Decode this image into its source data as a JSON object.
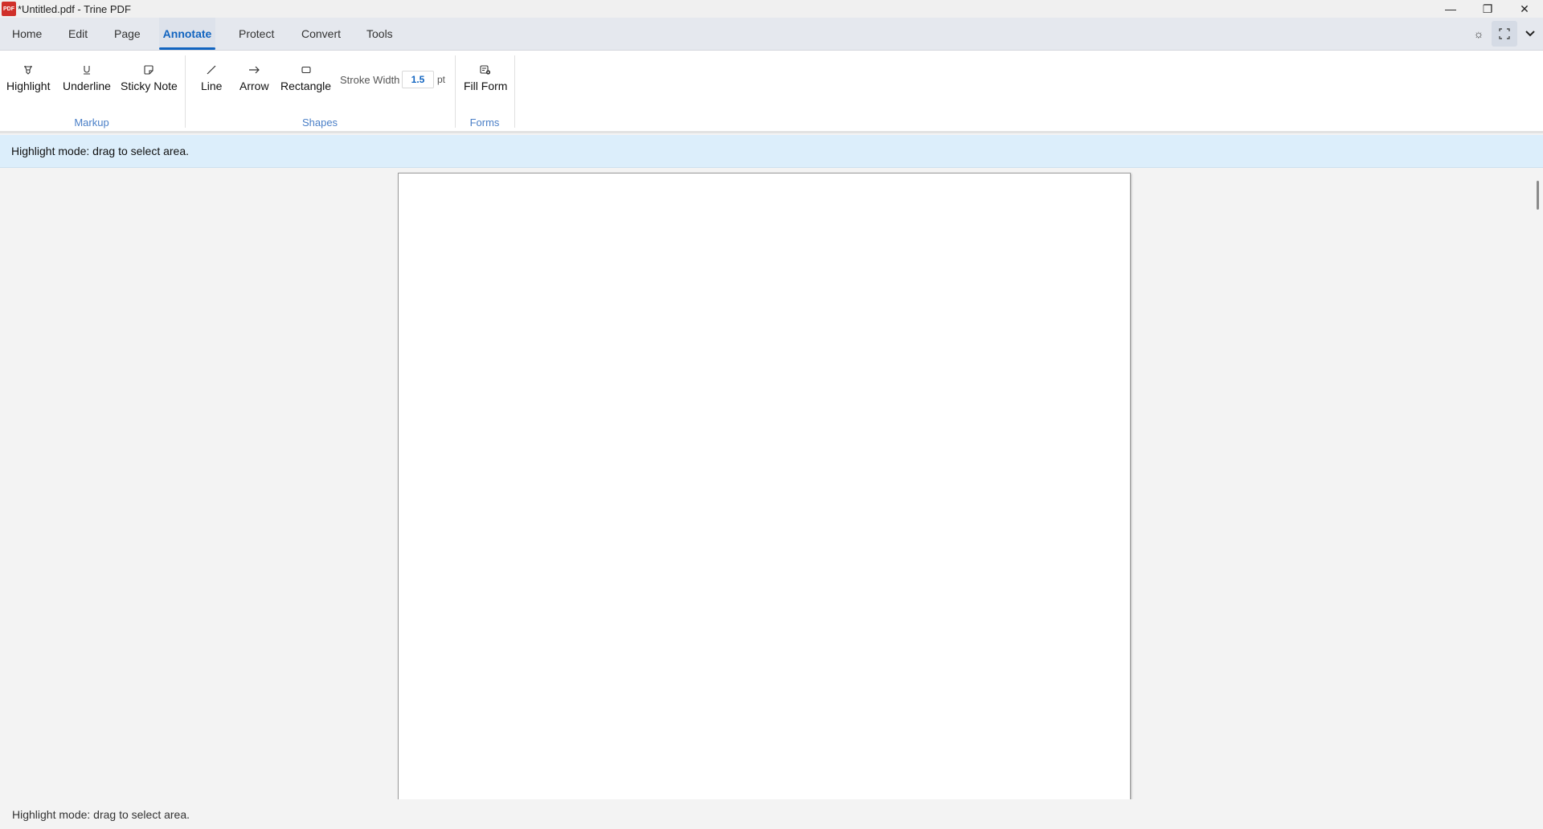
{
  "window": {
    "app_icon_text": "PDF",
    "title": "*Untitled.pdf - Trine PDF",
    "minimize": "—",
    "restore": "❐",
    "close": "✕"
  },
  "tabs": [
    {
      "label": "Home"
    },
    {
      "label": "Edit"
    },
    {
      "label": "Page"
    },
    {
      "label": "Annotate",
      "active": true
    },
    {
      "label": "Protect"
    },
    {
      "label": "Convert"
    },
    {
      "label": "Tools"
    }
  ],
  "tabbar_icons": {
    "theme": "☼",
    "fullscreen": "⛶",
    "collapse": "⌄"
  },
  "ribbon": {
    "markup": {
      "group_label": "Markup",
      "highlight": "Highlight",
      "underline": "Underline",
      "sticky_note": "Sticky Note"
    },
    "shapes": {
      "group_label": "Shapes",
      "line": "Line",
      "arrow": "Arrow",
      "rectangle": "Rectangle",
      "stroke_width_label": "Stroke Width",
      "stroke_width_value": "1.5",
      "stroke_width_unit": "pt"
    },
    "forms": {
      "group_label": "Forms",
      "fill_form": "Fill Form"
    }
  },
  "info_message": "Highlight mode: drag to select area.",
  "status_message": "Highlight mode: drag to select area.",
  "colors": {
    "accent": "#1164c0",
    "group_label": "#4a7fc7",
    "info_bg": "#dceefb"
  }
}
